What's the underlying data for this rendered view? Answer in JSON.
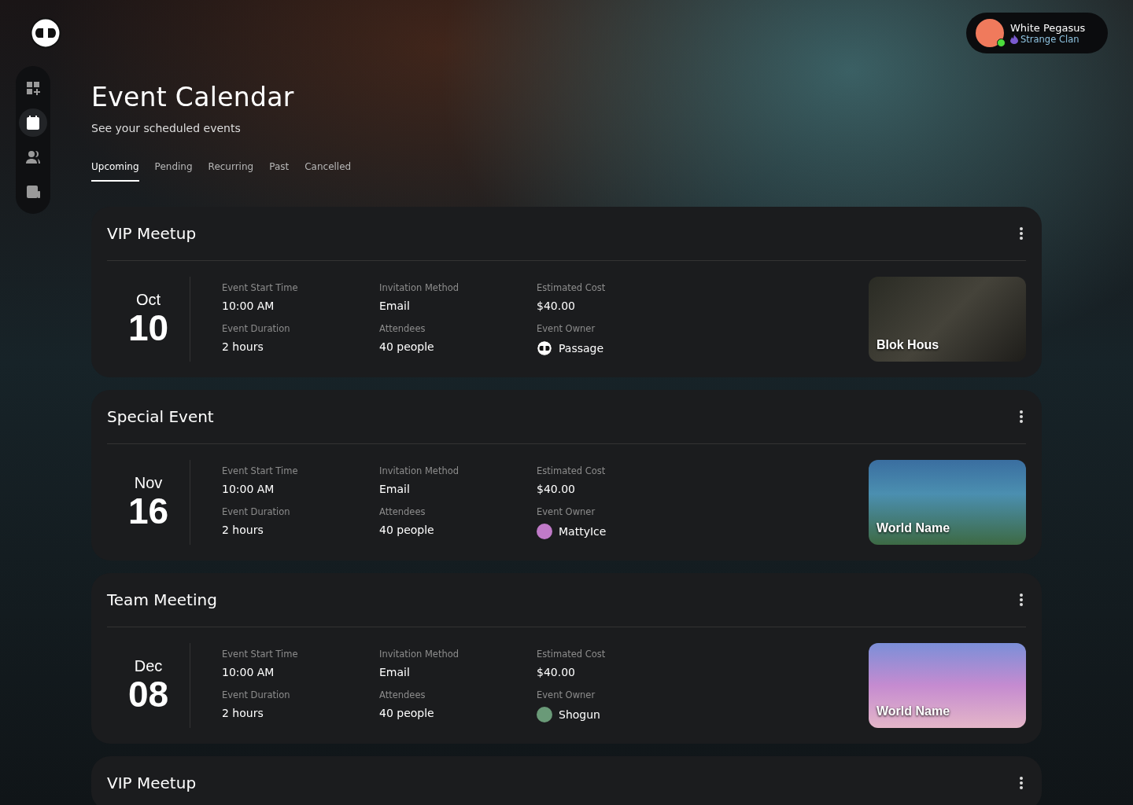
{
  "sidebar": {
    "items": [
      {
        "kind": "dashboard",
        "selected": false
      },
      {
        "kind": "calendar",
        "selected": true
      },
      {
        "kind": "people",
        "selected": false
      },
      {
        "kind": "news",
        "selected": false
      }
    ]
  },
  "user": {
    "name": "White Pegasus",
    "clan": "Strange Clan",
    "online": true
  },
  "header": {
    "title": "Event Calendar",
    "subtitle": "See your scheduled events"
  },
  "tabs": [
    {
      "label": "Upcoming",
      "selected": true
    },
    {
      "label": "Pending",
      "selected": false
    },
    {
      "label": "Recurring",
      "selected": false
    },
    {
      "label": "Past",
      "selected": false
    },
    {
      "label": "Cancelled",
      "selected": false
    }
  ],
  "events": [
    {
      "title": "VIP Meetup",
      "month": "Oct",
      "day": "10",
      "fields": [
        {
          "label": "Event Start Time",
          "value": "10:00 AM"
        },
        {
          "label": "Invitation Method",
          "value": "Email"
        },
        {
          "label": "Estimated Cost",
          "value": "$40.00"
        },
        {
          "label": "Event Duration",
          "value": "2 hours"
        },
        {
          "label": "Attendees",
          "value": "40 people"
        }
      ],
      "owner": {
        "label": "Event Owner",
        "name": "Passage",
        "kind": "logo"
      },
      "thumbnail": "Blok Hous"
    },
    {
      "title": "Special Event",
      "month": "Nov",
      "day": "16",
      "fields": [
        {
          "label": "Event Start Time",
          "value": "10:00 AM"
        },
        {
          "label": "Invitation Method",
          "value": "Email"
        },
        {
          "label": "Estimated Cost",
          "value": "$40.00"
        },
        {
          "label": "Event Duration",
          "value": "2 hours"
        },
        {
          "label": "Attendees",
          "value": "40 people"
        }
      ],
      "owner": {
        "label": "Event Owner",
        "name": "MattyIce",
        "kind": "avatar"
      },
      "thumbnail": "World Name"
    },
    {
      "title": "Team Meeting",
      "month": "Dec",
      "day": "08",
      "fields": [
        {
          "label": "Event Start Time",
          "value": "10:00 AM"
        },
        {
          "label": "Invitation Method",
          "value": "Email"
        },
        {
          "label": "Estimated Cost",
          "value": "$40.00"
        },
        {
          "label": "Event Duration",
          "value": "2 hours"
        },
        {
          "label": "Attendees",
          "value": "40 people"
        }
      ],
      "owner": {
        "label": "Event Owner",
        "name": "Shogun",
        "kind": "avatar"
      },
      "thumbnail": "World Name"
    },
    {
      "title": "VIP Meetup"
    }
  ]
}
